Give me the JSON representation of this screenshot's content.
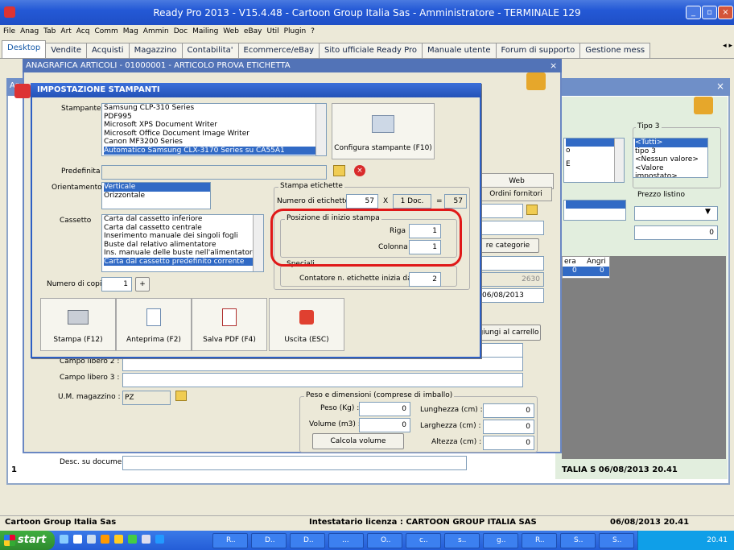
{
  "app": {
    "title": "Ready Pro 2013 - V15.4.48 - Cartoon Group Italia Sas - Amministratore - TERMINALE 129",
    "minimize": "_",
    "maximize": "▫",
    "close": "×"
  },
  "menu": [
    "File",
    "Anag",
    "Tab",
    "Art",
    "Acq",
    "Comm",
    "Mag",
    "Ammin",
    "Doc",
    "Mailing",
    "Web",
    "eBay",
    "Util",
    "Plugin",
    "?"
  ],
  "tabs": [
    "Desktop",
    "Vendite",
    "Acquisti",
    "Magazzino",
    "Contabilita'",
    "Ecommerce/eBay",
    "Sito ufficiale Ready Pro",
    "Manuale utente",
    "Forum di supporto",
    "Gestione mess"
  ],
  "tab_scroll": "◂ ▸",
  "anagrafica": {
    "title": "ANAGRAFICA ARTICOLI - 01000001 - ARTICOLO PROVA ETICHETTA",
    "close": "×",
    "bg_short_title": "Ar",
    "bg_close": "×",
    "web_tab": "Web",
    "ordini_fornitori": "Ordini fornitori",
    "categorie_btn": "re categorie",
    "date_field": "06/08/2013",
    "value_2630": "2630",
    "carrello_btn": "giungi al carrello",
    "campo_libero_2": "Campo libero 2 :",
    "campo_libero_3": "Campo libero 3 :",
    "um_label": "U.M. magazzino :",
    "um_value": "PZ",
    "peso_group": "Peso e dimensioni (comprese di imballo)",
    "peso_label": "Peso (Kg) :",
    "peso_value": "0",
    "volume_label": "Volume (m3) :",
    "volume_value": "0",
    "lunghezza_label": "Lunghezza (cm) :",
    "lunghezza_value": "0",
    "larghezza_label": "Larghezza (cm) :",
    "larghezza_value": "0",
    "altezza_label": "Altezza (cm) :",
    "altezza_value": "0",
    "calcola_btn": "Calcola volume",
    "desc_label": "Desc. su documenti:",
    "left_1": "1"
  },
  "right_panel": {
    "tipo3_label": "Tipo 3",
    "tipo3_items": [
      "<Tutti>",
      "tipo 3",
      "<Nessun valore>",
      "<Valore impostato>"
    ],
    "prezzo_label": "Prezzo listino",
    "prezzo_value": "0",
    "col_a": "era",
    "col_b": "Angri",
    "col_a_val": "0",
    "col_b_val": "0",
    "small_o": "o",
    "small_e": "E",
    "bottom_text": "TALIA S  06/08/2013   20.41"
  },
  "dialog": {
    "title": "IMPOSTAZIONE STAMPANTI",
    "stampante_label": "Stampante",
    "printers": [
      "Samsung CLP-310 Series",
      "PDF995",
      "Microsoft XPS Document Writer",
      "Microsoft Office Document Image Writer",
      "Canon MF3200 Series",
      "Automatico Samsung CLX-3170 Series su CA55A1"
    ],
    "configura_btn": "Configura stampante (F10)",
    "predefinita_label": "Predefinita",
    "orientamento_label": "Orientamento",
    "orientations": [
      "Verticale",
      "Orizzontale"
    ],
    "cassetto_label": "Cassetto",
    "cassetti": [
      "Carta dal cassetto inferiore",
      "Carta dal cassetto centrale",
      "Inserimento manuale dei singoli fogli",
      "Buste dal relativo alimentatore",
      "Ins. manuale delle buste nell'alimentatore",
      "Carta dal cassetto predefinito corrente"
    ],
    "copie_label": "Numero di copie",
    "copie_value": "1",
    "copie_plus": "+",
    "stampa_etichette_group": "Stampa etichette",
    "num_etichette_label": "Numero di etichette",
    "num_etichette_value": "57",
    "x_label": "X",
    "doc_value": "1 Doc.",
    "eq_label": "=",
    "total_value": "57",
    "posizione_group": "Posizione di inizio stampa",
    "riga_label": "Riga",
    "riga_value": "1",
    "colonna_label": "Colonna",
    "colonna_value": "1",
    "speciali_group": "Speciali",
    "contatore_label": "Contatore n. etichette inizia da",
    "contatore_value": "2",
    "buttons": [
      "Stampa (F12)",
      "Anteprima (F2)",
      "Salva PDF (F4)",
      "Uscita (ESC)"
    ]
  },
  "status": {
    "company": "Cartoon Group Italia Sas",
    "license": "Intestatario licenza : CARTOON GROUP ITALIA SAS",
    "datetime": "06/08/2013   20.41"
  },
  "taskbar": {
    "start": "start",
    "tasks": [
      "R..",
      "D..",
      "D..",
      "...",
      "O..",
      "c..",
      "s..",
      "g..",
      "R..",
      "S..",
      "S.."
    ],
    "clock": "20.41"
  },
  "colors": {
    "title_blue": "#2459D6",
    "selection": "#316ac5",
    "annotation_red": "#e01818"
  }
}
